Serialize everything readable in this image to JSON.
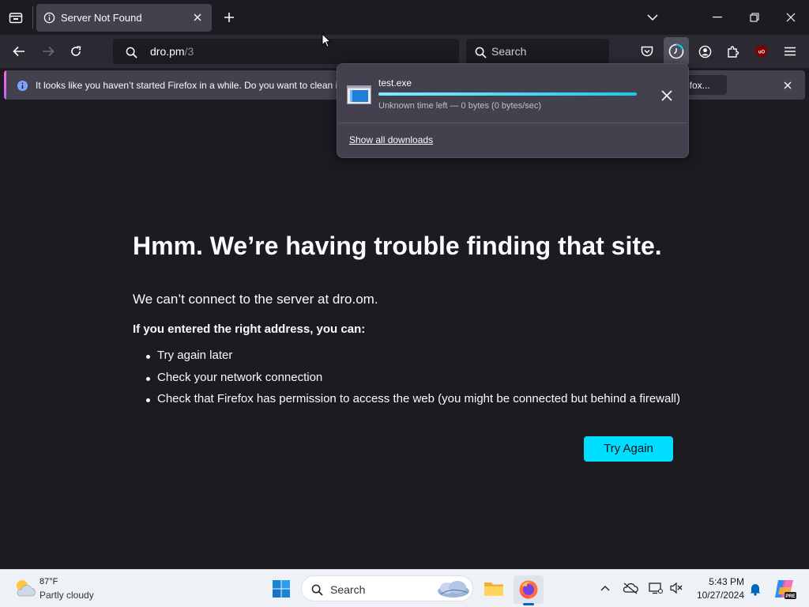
{
  "tab": {
    "title": "Server Not Found"
  },
  "urlbar": {
    "host": "dro.pm",
    "path": "/3"
  },
  "searchbar": {
    "placeholder": "Search"
  },
  "notification": {
    "message": "It looks like you haven’t started Firefox in a while. Do you want to clean it",
    "button_label": "efox..."
  },
  "downloads": {
    "filename": "test.exe",
    "status": "Unknown time left — 0 bytes (0 bytes/sec)",
    "progress_percent": 100,
    "show_all_label": "Show all downloads"
  },
  "error_page": {
    "title": "Hmm. We’re having trouble finding that site.",
    "subtitle": "We can’t connect to the server at dro.om.",
    "suggestions_label": "If you entered the right address, you can:",
    "suggestions": [
      "Try again later",
      "Check your network connection",
      "Check that Firefox has permission to access the web (you might be connected but behind a firewall)"
    ],
    "try_again_label": "Try Again"
  },
  "taskbar": {
    "weather_temp": "87°F",
    "weather_desc": "Partly cloudy",
    "search_placeholder": "Search",
    "time": "5:43 PM",
    "date": "10/27/2024",
    "copilot_badge": "PRE"
  },
  "colors": {
    "accent": "#00ddff",
    "page_bg": "#1c1b22",
    "toolbar_bg": "#2b2a33",
    "panel_bg": "#42414d",
    "ublock_red": "#800000"
  }
}
